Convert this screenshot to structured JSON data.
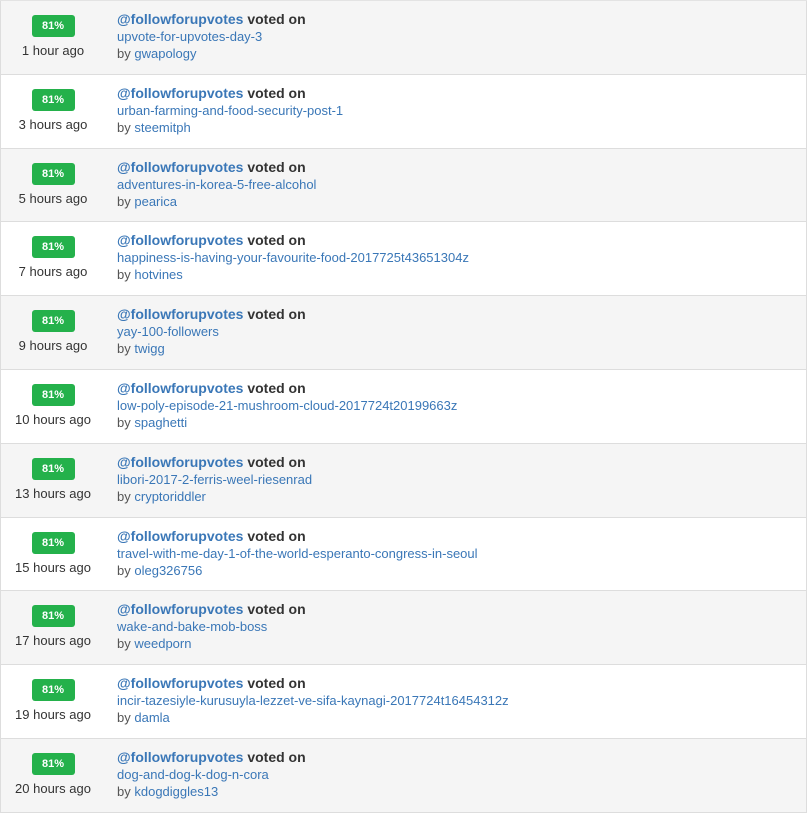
{
  "voter": "@followforupvotes",
  "voted_label": "voted on",
  "by_label": "by",
  "colors": {
    "badge": "#24b14b",
    "link": "#3a77b7",
    "row_alt": "#f5f5f5"
  },
  "votes": [
    {
      "percent": "81%",
      "time": "1 hour ago",
      "permlink": "upvote-for-upvotes-day-3",
      "author": "gwapology"
    },
    {
      "percent": "81%",
      "time": "3 hours ago",
      "permlink": "urban-farming-and-food-security-post-1",
      "author": "steemitph"
    },
    {
      "percent": "81%",
      "time": "5 hours ago",
      "permlink": "adventures-in-korea-5-free-alcohol",
      "author": "pearica"
    },
    {
      "percent": "81%",
      "time": "7 hours ago",
      "permlink": "happiness-is-having-your-favourite-food-2017725t43651304z",
      "author": "hotvines"
    },
    {
      "percent": "81%",
      "time": "9 hours ago",
      "permlink": "yay-100-followers",
      "author": "twigg"
    },
    {
      "percent": "81%",
      "time": "10 hours ago",
      "permlink": "low-poly-episode-21-mushroom-cloud-2017724t20199663z",
      "author": "spaghetti"
    },
    {
      "percent": "81%",
      "time": "13 hours ago",
      "permlink": "libori-2017-2-ferris-weel-riesenrad",
      "author": "cryptoriddler"
    },
    {
      "percent": "81%",
      "time": "15 hours ago",
      "permlink": "travel-with-me-day-1-of-the-world-esperanto-congress-in-seoul",
      "author": "oleg326756"
    },
    {
      "percent": "81%",
      "time": "17 hours ago",
      "permlink": "wake-and-bake-mob-boss",
      "author": "weedporn"
    },
    {
      "percent": "81%",
      "time": "19 hours ago",
      "permlink": "incir-tazesiyle-kurusuyla-lezzet-ve-sifa-kaynagi-2017724t16454312z",
      "author": "damla"
    },
    {
      "percent": "81%",
      "time": "20 hours ago",
      "permlink": "dog-and-dog-k-dog-n-cora",
      "author": "kdogdiggles13"
    }
  ]
}
